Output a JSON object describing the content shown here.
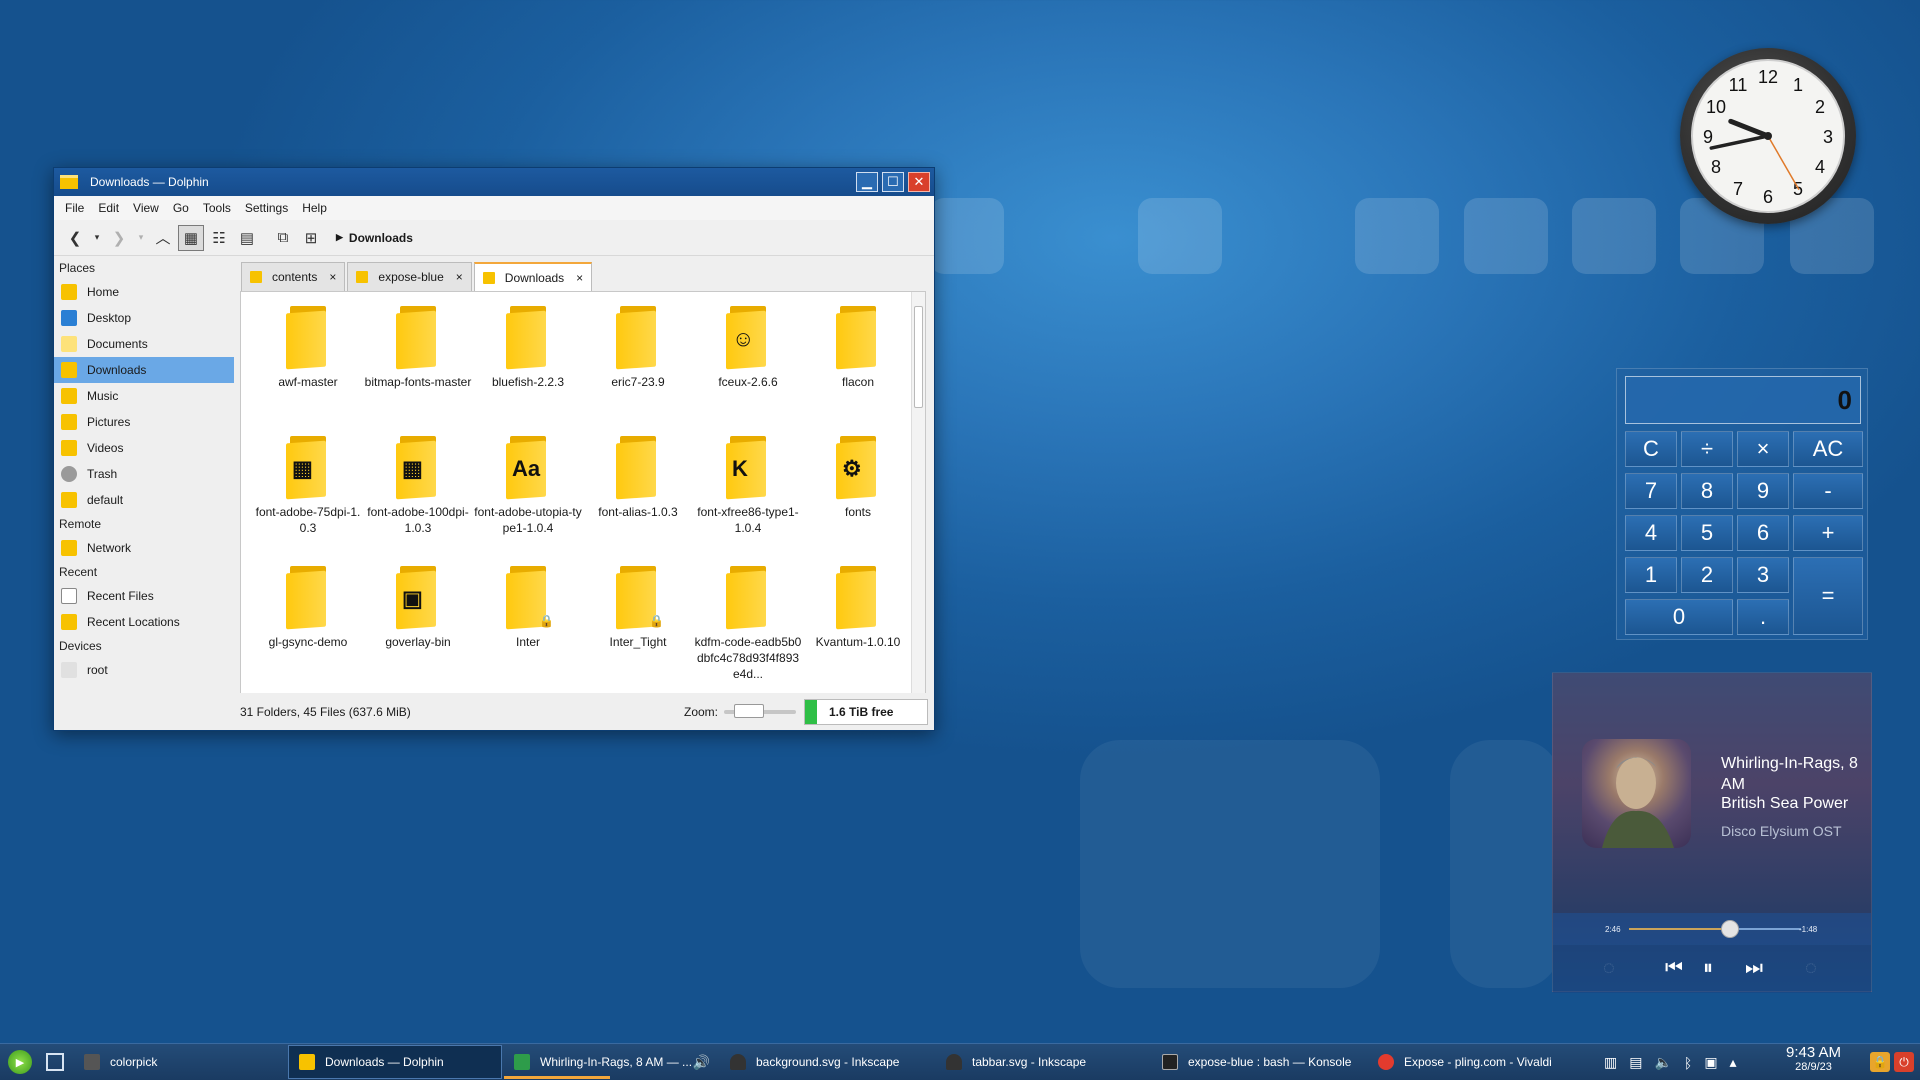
{
  "window": {
    "title": "Downloads — Dolphin",
    "menu": [
      "File",
      "Edit",
      "View",
      "Go",
      "Tools",
      "Settings",
      "Help"
    ],
    "breadcrumb": "Downloads",
    "places": {
      "header": "Places",
      "items": [
        "Home",
        "Desktop",
        "Documents",
        "Downloads",
        "Music",
        "Pictures",
        "Videos",
        "Trash",
        "default"
      ],
      "selected": "Downloads",
      "remote_header": "Remote",
      "remote_items": [
        "Network"
      ],
      "recent_header": "Recent",
      "recent_items": [
        "Recent Files",
        "Recent Locations"
      ],
      "devices_header": "Devices",
      "device_items": [
        "root"
      ]
    },
    "tabs": [
      {
        "label": "contents",
        "close": "×"
      },
      {
        "label": "expose-blue",
        "close": "×"
      },
      {
        "label": "Downloads",
        "close": "×",
        "active": true
      }
    ],
    "files": [
      {
        "name": "awf-master",
        "emblem": ""
      },
      {
        "name": "bitmap-fonts-master",
        "emblem": ""
      },
      {
        "name": "bluefish-2.2.3",
        "emblem": ""
      },
      {
        "name": "eric7-23.9",
        "emblem": ""
      },
      {
        "name": "fceux-2.6.6",
        "emblem": "fceux-icon"
      },
      {
        "name": "flacon",
        "emblem": ""
      },
      {
        "name": "font-adobe-75dpi-1.0.3",
        "emblem": "bitmap-font-icon"
      },
      {
        "name": "font-adobe-100dpi-1.0.3",
        "emblem": "bitmap-font-icon"
      },
      {
        "name": "font-adobe-utopia-type1-1.0.4",
        "emblem": "type1-font-icon"
      },
      {
        "name": "font-alias-1.0.3",
        "emblem": ""
      },
      {
        "name": "font-xfree86-type1-1.0.4",
        "emblem": "k-font-icon"
      },
      {
        "name": "fonts",
        "emblem": "font-tools-icon"
      },
      {
        "name": "gl-gsync-demo",
        "emblem": ""
      },
      {
        "name": "goverlay-bin",
        "emblem": "overlay-icon"
      },
      {
        "name": "Inter",
        "emblem": "lock-icon"
      },
      {
        "name": "Inter_Tight",
        "emblem": "lock-icon"
      },
      {
        "name": "kdfm-code-eadb5b0dbfc4c78d93f4f893e4d...",
        "emblem": ""
      },
      {
        "name": "Kvantum-1.0.10",
        "emblem": ""
      }
    ],
    "status": "31 Folders, 45 Files (637.6 MiB)",
    "zoom_label": "Zoom:",
    "free_space": "1.6 TiB free"
  },
  "calculator": {
    "display": "0",
    "buttons": [
      "C",
      "÷",
      "×",
      "AC",
      "7",
      "8",
      "9",
      "-",
      "4",
      "5",
      "6",
      "+",
      "1",
      "2",
      "3",
      "=",
      "0",
      "."
    ]
  },
  "player": {
    "title": "Whirling-In-Rags, 8 AM",
    "artist": "British Sea Power",
    "album": "Disco Elysium OST",
    "elapsed": "2:46",
    "remaining": "-1:48",
    "progress": 0.59
  },
  "clock": {
    "numerals": [
      "12",
      "1",
      "2",
      "3",
      "4",
      "5",
      "6",
      "7",
      "8",
      "9",
      "10",
      "11"
    ],
    "hour": 9,
    "minute": 43,
    "second": 25
  },
  "taskbar": {
    "tasks": [
      {
        "label": "colorpick",
        "active": false
      },
      {
        "label": "Downloads — Dolphin",
        "active": true
      },
      {
        "label": "Whirling-In-Rags, 8 AM — ...",
        "active": false
      },
      {
        "label": "background.svg - Inkscape",
        "active": false
      },
      {
        "label": "tabbar.svg - Inkscape",
        "active": false
      },
      {
        "label": "expose-blue : bash — Konsole",
        "active": false
      },
      {
        "label": "Expose - pling.com - Vivaldi",
        "active": false
      }
    ],
    "time": "9:43 AM",
    "date": "28/9/23"
  },
  "colors": {
    "accent": "#f3a73b",
    "selection": "#6aa8e6",
    "folder": "#ffc90f",
    "free_bar": "#2fbf46"
  }
}
